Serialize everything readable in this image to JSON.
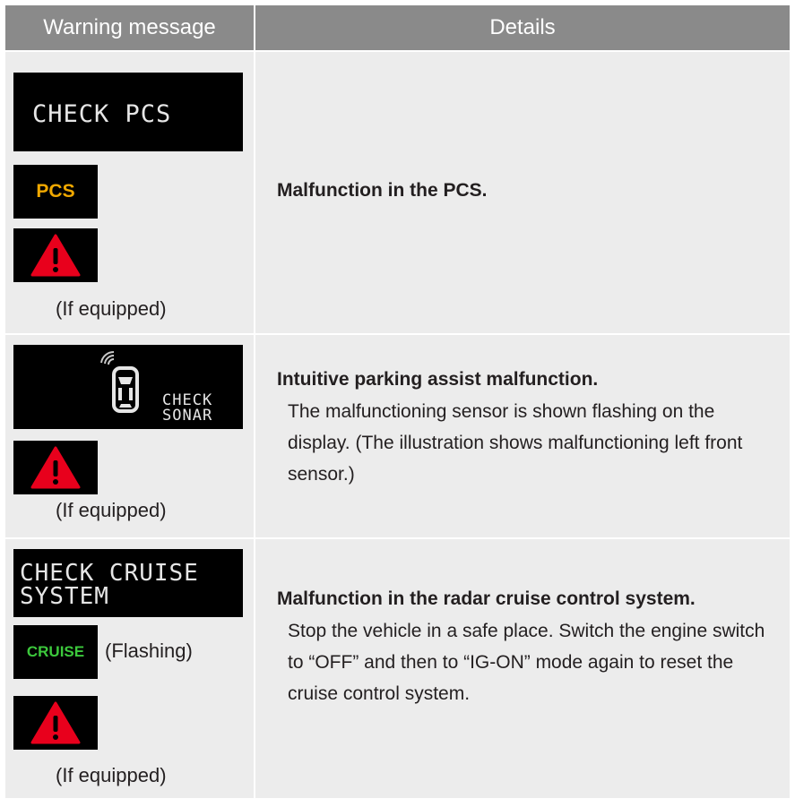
{
  "header": {
    "col1": "Warning message",
    "col2": "Details"
  },
  "rows": [
    {
      "lcd": "CHECK PCS",
      "indicator": {
        "label": "PCS",
        "color": "#f0a800"
      },
      "icon": "master-warning-icon",
      "note": "(If equipped)",
      "title": "Malfunction in the PCS.",
      "body": ""
    },
    {
      "lcd_line1": "CHECK",
      "lcd_line2": "SONAR",
      "icon": "master-warning-icon",
      "note": "(If equipped)",
      "title": "Intuitive parking assist malfunction.",
      "body": "The malfunctioning sensor is shown flashing on the display. (The illustration shows malfunctioning left front sensor.)"
    },
    {
      "lcd_line1": "CHECK CRUISE",
      "lcd_line2": "SYSTEM",
      "indicator": {
        "label": "CRUISE",
        "color": "#3cc83c"
      },
      "indicator_note": "(Flashing)",
      "icon": "master-warning-icon",
      "note": "(If equipped)",
      "title": "Malfunction in the radar cruise control system.",
      "body": "Stop the vehicle in a safe place. Switch the engine switch to “OFF” and then to “IG-ON” mode again to reset the cruise control system."
    }
  ],
  "colors": {
    "header_bg": "#8a8a8a",
    "cell_bg": "#ececec",
    "warning_red": "#e8001c"
  }
}
